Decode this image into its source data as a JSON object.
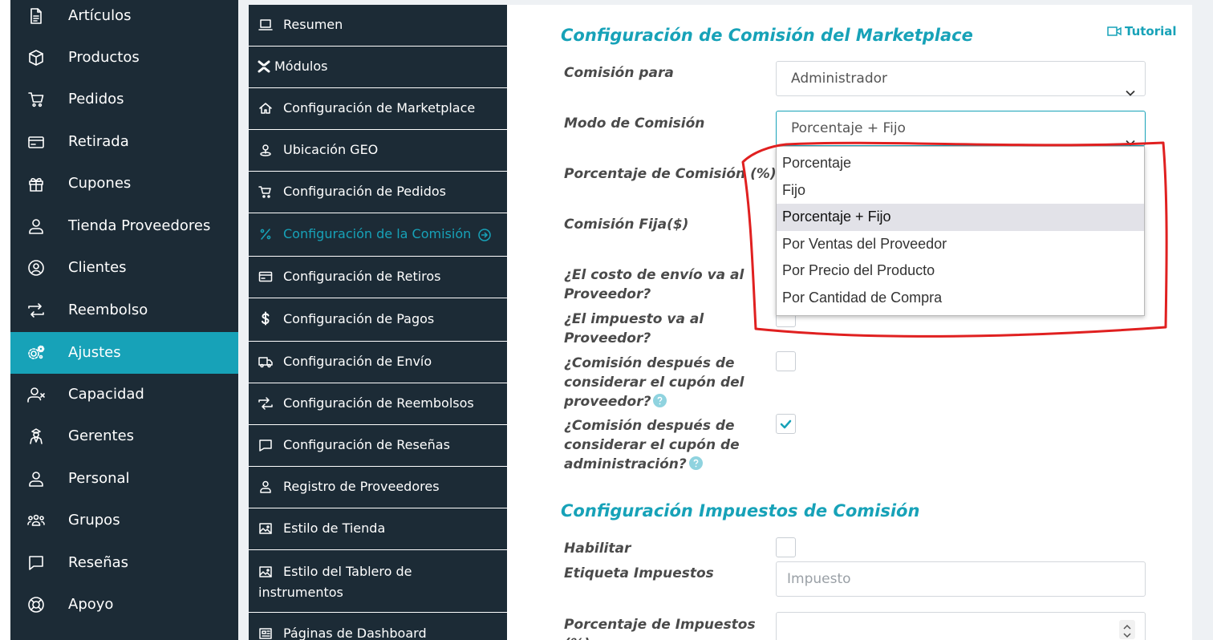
{
  "main_sidebar": {
    "items": [
      {
        "label": "Artículos",
        "icon": "document-icon",
        "active": false
      },
      {
        "label": "Productos",
        "icon": "cube-icon",
        "active": false
      },
      {
        "label": "Pedidos",
        "icon": "cart-icon",
        "active": false
      },
      {
        "label": "Retirada",
        "icon": "credit-card-icon",
        "active": false
      },
      {
        "label": "Cupones",
        "icon": "gift-icon",
        "active": false
      },
      {
        "label": "Tienda Proveedores",
        "icon": "user-icon",
        "active": false
      },
      {
        "label": "Clientes",
        "icon": "user-circle-icon",
        "active": false
      },
      {
        "label": "Reembolso",
        "icon": "refund-arrows-icon",
        "active": false
      },
      {
        "label": "Ajustes",
        "icon": "gears-icon",
        "active": true
      },
      {
        "label": "Capacidad",
        "icon": "user-x-icon",
        "active": false
      },
      {
        "label": "Gerentes",
        "icon": "manager-icon",
        "active": false
      },
      {
        "label": "Personal",
        "icon": "user-icon",
        "active": false
      },
      {
        "label": "Grupos",
        "icon": "group-icon",
        "active": false
      },
      {
        "label": "Reseñas",
        "icon": "chat-bubble-icon",
        "active": false
      },
      {
        "label": "Apoyo",
        "icon": "lifebuoy-icon",
        "active": false
      }
    ]
  },
  "settings_nav": {
    "items": [
      {
        "label": "Resumen",
        "icon": "laptop-icon"
      },
      {
        "label": "Módulos",
        "icon": "modules-icon"
      },
      {
        "label": "Configuración de Marketplace",
        "icon": "home-icon"
      },
      {
        "label": "Ubicación GEO",
        "icon": "location-icon"
      },
      {
        "label": "Configuración de Pedidos",
        "icon": "cart-icon"
      },
      {
        "label": "Configuración de la Comisión",
        "icon": "percent-icon",
        "active": true
      },
      {
        "label": "Configuración de Retiros",
        "icon": "credit-card-icon"
      },
      {
        "label": "Configuración de Pagos",
        "icon": "dollar-icon"
      },
      {
        "label": "Configuración de Envío",
        "icon": "truck-icon"
      },
      {
        "label": "Configuración de Reembolsos",
        "icon": "refund-arrows-icon"
      },
      {
        "label": "Configuración de Reseñas",
        "icon": "chat-bubble-icon"
      },
      {
        "label": "Registro de Proveedores",
        "icon": "user-icon"
      },
      {
        "label": "Estilo de Tienda",
        "icon": "image-icon"
      },
      {
        "label": "Estilo del Tablero de instrumentos",
        "icon": "image-icon"
      },
      {
        "label": "Páginas de Dashboard",
        "icon": "newspaper-icon"
      }
    ]
  },
  "commission": {
    "title": "Configuración de Comisión del Marketplace",
    "tutorial_label": "Tutorial",
    "commission_for_label": "Comisión para",
    "commission_for_value": "Administrador",
    "mode_label": "Modo de Comisión",
    "mode_value": "Porcentaje + Fijo",
    "percent_label": "Porcentaje de Comisión (%)",
    "fixed_label": "Comisión Fija($)",
    "shipping_label": "¿El costo de envío va al Proveedor?",
    "tax_label": "¿El impuesto va al Proveedor?",
    "after_vendor_coupon_label": "¿Comisión después de considerar el cupón del proveedor?",
    "after_admin_coupon_label": "¿Comisión después de considerar el cupón de administración?",
    "after_vendor_coupon_checked": false,
    "after_admin_coupon_checked": true
  },
  "mode_dropdown": {
    "options": [
      "Porcentaje",
      "Fijo",
      "Porcentaje + Fijo",
      "Por Ventas del Proveedor",
      "Por Precio del Producto",
      "Por Cantidad de Compra"
    ],
    "selected_index": 2
  },
  "tax": {
    "title": "Configuración Impuestos de Comisión",
    "enable_label": "Habilitar",
    "enable_checked": false,
    "tax_label_label": "Etiqueta Impuestos",
    "tax_label_placeholder": "Impuesto",
    "tax_percent_label": "Porcentaje de Impuestos (%)"
  },
  "colors": {
    "sidebar_bg": "#1c2b36",
    "accent": "#17a2b8",
    "annotation": "#e02020"
  }
}
